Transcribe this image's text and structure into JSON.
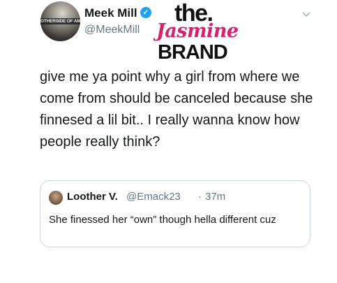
{
  "tweet": {
    "author_name": "Meek Mill",
    "author_handle": "@MeekMill",
    "avatar_banner_text": "OTHERSIDE OF AMERICA",
    "text": "give me ya point why a girl from where we come from should be canceled because she finnesed a lil bit.. I really wanna know how people really think?",
    "verified_icon": "checkmark-icon",
    "menu_icon": "chevron-down-icon"
  },
  "watermark": {
    "line1": "the.",
    "line2": "Jasmine",
    "line3": "BRAND",
    "accent_color": "#d6216f"
  },
  "quoted_tweet": {
    "author_name": "Loother V.",
    "author_handle": "@Emack23",
    "separator": "·",
    "time": "37m",
    "text": "She finessed her “own” though hella different cuz"
  },
  "colors": {
    "verified_blue": "#1da1f2",
    "secondary_text": "#657786",
    "border": "#ccd6dd"
  }
}
